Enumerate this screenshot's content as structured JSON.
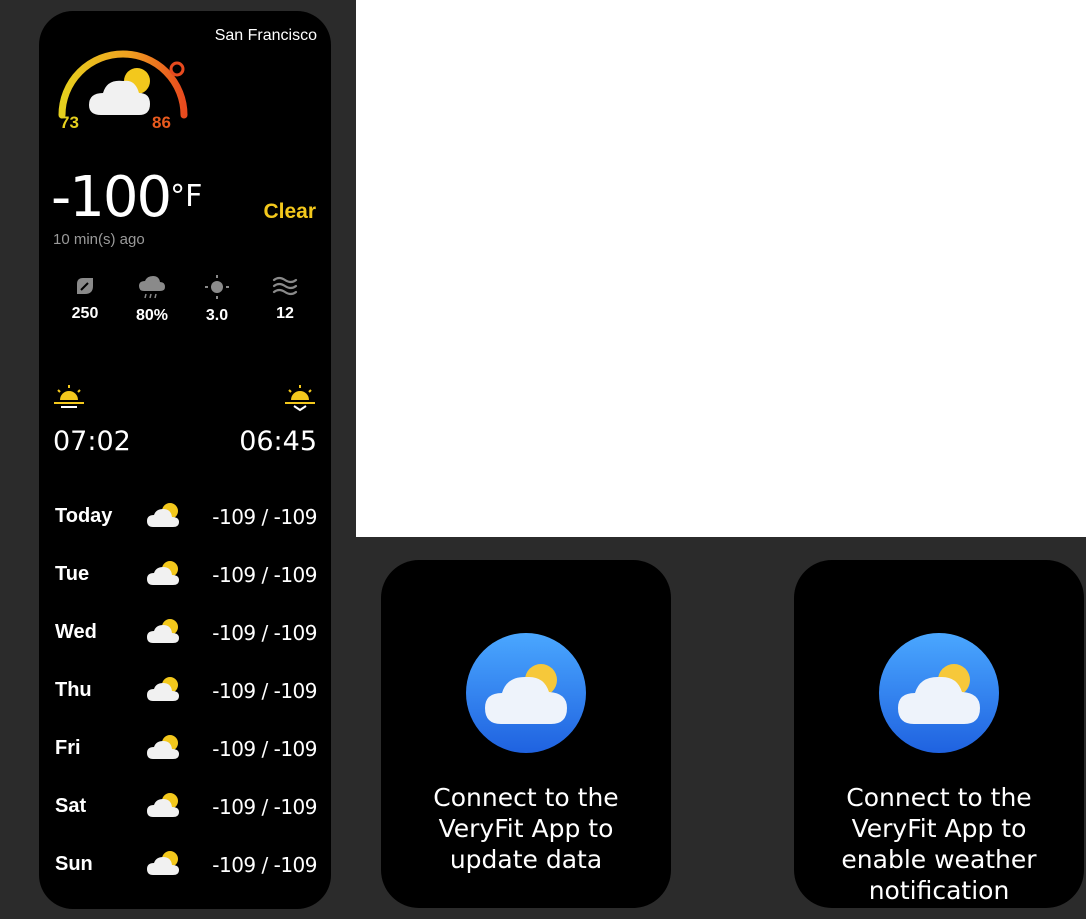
{
  "weather": {
    "city": "San Francisco",
    "low": "73",
    "high": "86",
    "temperature": "-100",
    "unit": "°F",
    "condition": "Clear",
    "updated": "10 min(s) ago",
    "stats": [
      {
        "icon": "leaf-icon",
        "value": "250"
      },
      {
        "icon": "rain-cloud-icon",
        "value": "80%"
      },
      {
        "icon": "sun-uv-icon",
        "value": "3.0"
      },
      {
        "icon": "wind-icon",
        "value": "12"
      }
    ],
    "sunrise": "07:02",
    "sunset": "06:45",
    "forecast": [
      {
        "day": "Today",
        "range": "-109 / -109"
      },
      {
        "day": "Tue",
        "range": "-109 / -109"
      },
      {
        "day": "Wed",
        "range": "-109 / -109"
      },
      {
        "day": "Thu",
        "range": "-109 / -109"
      },
      {
        "day": "Fri",
        "range": "-109 / -109"
      },
      {
        "day": "Sat",
        "range": "-109 / -109"
      },
      {
        "day": "Sun",
        "range": "-109 / -109"
      }
    ]
  },
  "cards": [
    {
      "message": "Connect to the VeryFit App to update data"
    },
    {
      "message": "Connect to the VeryFit App to enable weather notification"
    }
  ],
  "colors": {
    "accent_yellow": "#f3c81c",
    "gauge_low": "#e6d01e",
    "gauge_high": "#e85a1e",
    "app_icon_blue": "#2d7ff0"
  }
}
